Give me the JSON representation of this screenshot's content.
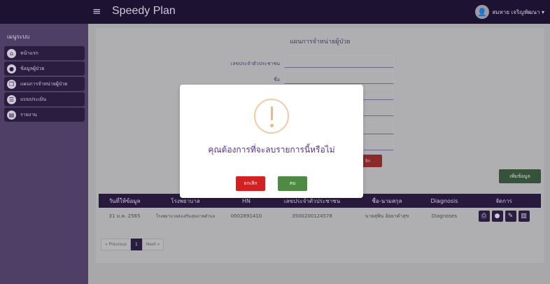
{
  "app": {
    "brand": "Speedy Plan",
    "user_name": "สมหาย เจริญพัฒนา ▾"
  },
  "sidebar": {
    "title": "เมนูระบบ",
    "items": [
      {
        "label": "หน้าแรก",
        "icon": "home-icon"
      },
      {
        "label": "ข้อมูลผู้ป่วย",
        "icon": "user-icon"
      },
      {
        "label": "แผนการจำหน่ายผู้ป่วย",
        "icon": "copy-icon"
      },
      {
        "label": "แบบประเมิน",
        "icon": "list-icon"
      },
      {
        "label": "รายงาน",
        "icon": "report-icon"
      }
    ]
  },
  "form": {
    "title": "แผนการจำหน่ายผู้ป่วย",
    "fields": [
      {
        "label": "เลขประจำตัวประชาชน"
      },
      {
        "label": "ชื่อ"
      }
    ],
    "add_button": "เพิ่มข้อมูล",
    "peek_button": "ลิก"
  },
  "table": {
    "headers": [
      "วันที่ให้ข้อมูล",
      "โรงพยาบาล",
      "HN",
      "เลขประจำตัวประชาชน",
      "ชื่อ-นามสกุล",
      "Diagnosis",
      "จัดการ"
    ],
    "rows": [
      [
        "31 ม.ค. 2565",
        "โรงพยาบาลส่งเสริมสุขภาพตำบล",
        "0002891410",
        "3500200124578",
        "นายสุพิน อัยยาคำสุข",
        "Diagnoses"
      ]
    ]
  },
  "pager": {
    "prev": "« Previous",
    "page": "1",
    "next": "Next »"
  },
  "modal": {
    "message": "คุณต้องการที่จะลบรายการนี้หรือไม่",
    "cancel_label": "ยกเลิก",
    "confirm_label": "ลบ"
  }
}
